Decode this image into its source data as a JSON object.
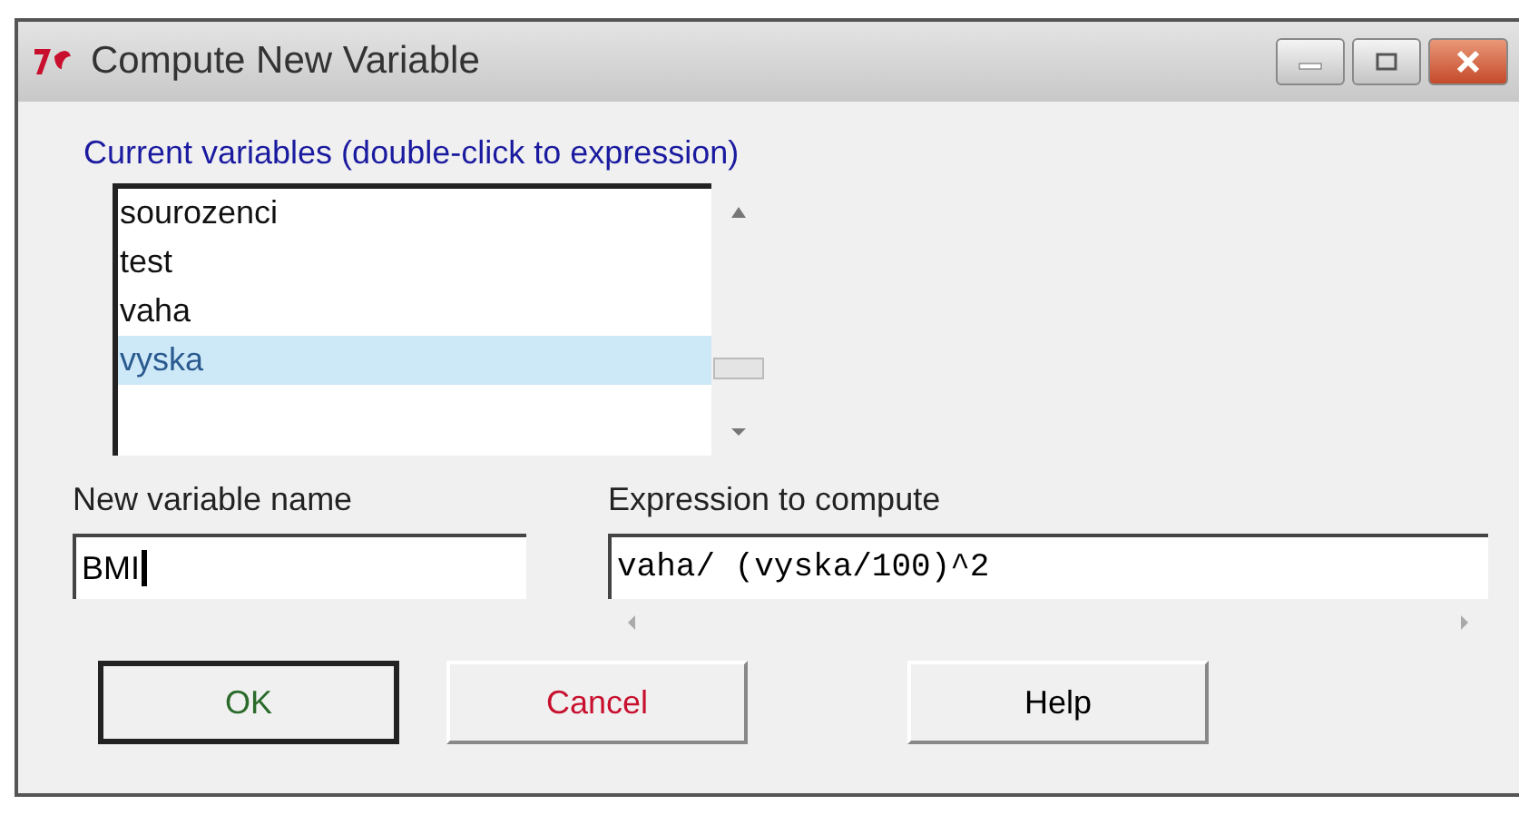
{
  "window": {
    "title": "Compute New Variable"
  },
  "variables": {
    "label": "Current variables (double-click to expression)",
    "items": [
      {
        "name": "sourozenci",
        "selected": false
      },
      {
        "name": "test",
        "selected": false
      },
      {
        "name": "vaha",
        "selected": false
      },
      {
        "name": "vyska",
        "selected": true
      }
    ]
  },
  "new_variable": {
    "label": "New variable name",
    "value": "BMI"
  },
  "expression": {
    "label": "Expression to compute",
    "value": "vaha/ (vyska/100)^2"
  },
  "buttons": [
    {
      "label": "OK",
      "color": "#2a6a2a",
      "default": true
    },
    {
      "label": "Cancel",
      "color": "#c8102e",
      "default": false
    },
    {
      "label": "Help",
      "color": "#000000",
      "default": false
    }
  ]
}
